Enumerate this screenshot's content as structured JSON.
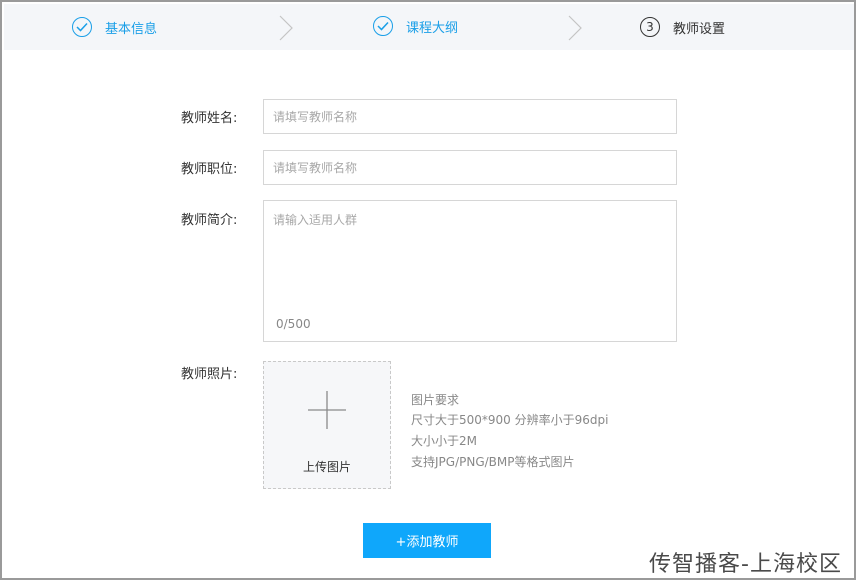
{
  "steps": [
    {
      "label": "基本信息",
      "status": "done"
    },
    {
      "label": "课程大纲",
      "status": "done"
    },
    {
      "label": "教师设置",
      "status": "current",
      "number": "3"
    }
  ],
  "form": {
    "name": {
      "label": "教师姓名:",
      "placeholder": "请填写教师名称",
      "value": ""
    },
    "position": {
      "label": "教师职位:",
      "placeholder": "请填写教师名称",
      "value": ""
    },
    "intro": {
      "label": "教师简介:",
      "placeholder": "请输入适用人群",
      "value": "",
      "counter": "0/500"
    },
    "photo": {
      "label": "教师照片:",
      "upload_label": "上传图片",
      "requirements": [
        "图片要求",
        "尺寸大于500*900 分辨率小于96dpi",
        "大小小于2M",
        "支持JPG/PNG/BMP等格式图片"
      ]
    }
  },
  "submit_label": "+添加教师",
  "watermark": "传智播客-上海校区",
  "colors": {
    "accent": "#1a9fe8",
    "button": "#0fa7fb"
  }
}
